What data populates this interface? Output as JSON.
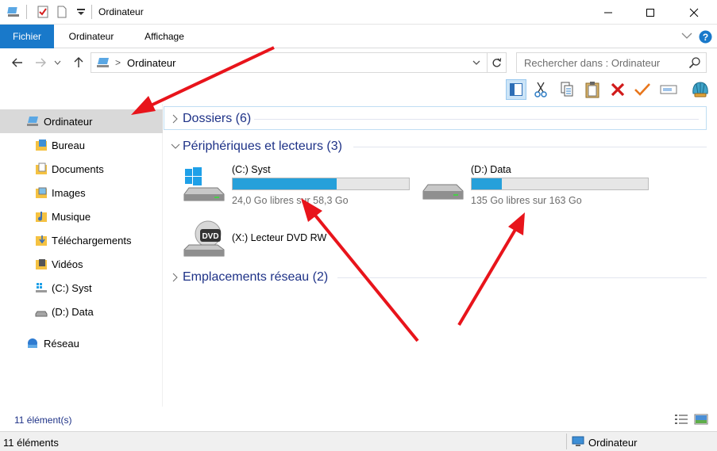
{
  "window": {
    "title": "Ordinateur",
    "controls": [
      "minimize",
      "maximize",
      "close"
    ]
  },
  "ribbon": {
    "tabs": [
      {
        "label": "Fichier",
        "active": true
      },
      {
        "label": "Ordinateur",
        "active": false
      },
      {
        "label": "Affichage",
        "active": false
      }
    ]
  },
  "address": {
    "path": "Ordinateur",
    "search_placeholder": "Rechercher dans : Ordinateur"
  },
  "sidebar": {
    "items": [
      {
        "label": "Ordinateur",
        "icon": "computer-icon",
        "selected": true
      },
      {
        "label": "Bureau",
        "icon": "desktop-folder-icon"
      },
      {
        "label": "Documents",
        "icon": "documents-folder-icon"
      },
      {
        "label": "Images",
        "icon": "images-folder-icon"
      },
      {
        "label": "Musique",
        "icon": "music-folder-icon"
      },
      {
        "label": "Téléchargements",
        "icon": "downloads-folder-icon"
      },
      {
        "label": "Vidéos",
        "icon": "videos-folder-icon"
      },
      {
        "label": "(C:) Syst",
        "icon": "windows-drive-icon"
      },
      {
        "label": "(D:) Data",
        "icon": "drive-icon"
      },
      {
        "label": "Réseau",
        "icon": "network-icon"
      }
    ]
  },
  "groups": {
    "folders": "Dossiers (6)",
    "devices": "Périphériques et lecteurs (3)",
    "network": "Emplacements réseau (2)"
  },
  "drives": [
    {
      "name": "(C:) Syst",
      "free": "24,0 Go libres sur 58,3 Go",
      "used_fraction": 0.59
    },
    {
      "name": "(D:) Data",
      "free": "135 Go libres sur 163 Go",
      "used_fraction": 0.17
    },
    {
      "name": "(X:) Lecteur DVD RW"
    }
  ],
  "status": {
    "item_count_top": "11 élément(s)",
    "item_count": "11 éléments",
    "location": "Ordinateur"
  },
  "colors": {
    "accent": "#1979ca",
    "bar_fill": "#26a0da",
    "group_header": "#1e3287",
    "annotation_arrow": "#e8141b"
  }
}
